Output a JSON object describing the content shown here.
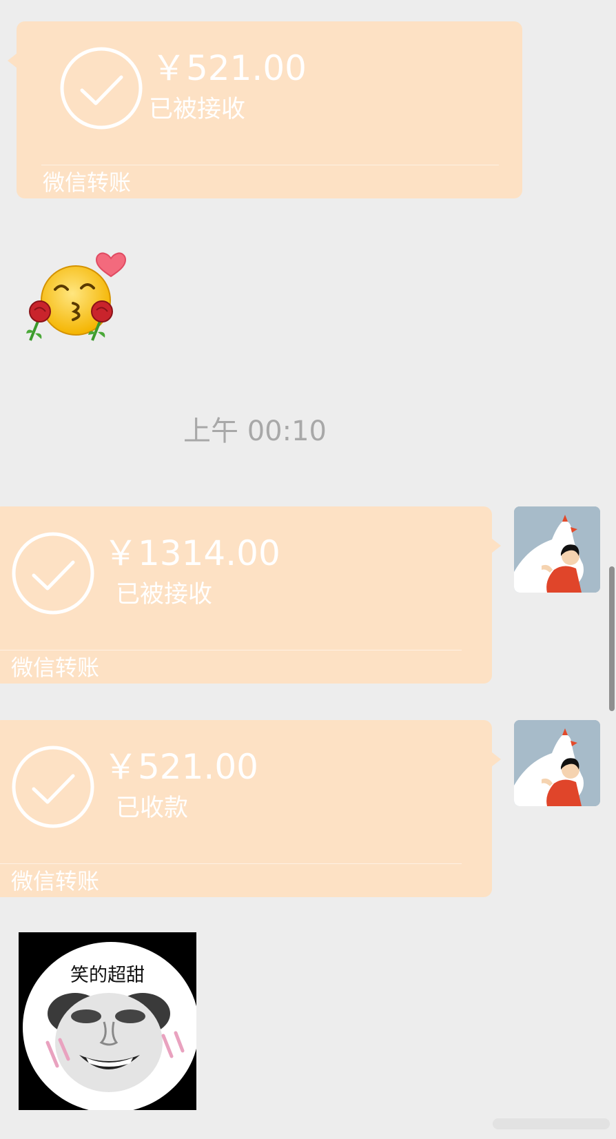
{
  "chat": {
    "timestamp": "上午 00:10",
    "messages": [
      {
        "type": "transfer",
        "direction": "incoming",
        "amount": "￥521.00",
        "status": "已被接收",
        "footer": "微信转账"
      },
      {
        "type": "sticker",
        "direction": "incoming",
        "sticker": "kiss-face-roses-heart"
      },
      {
        "type": "transfer",
        "direction": "outgoing",
        "amount": "￥1314.00",
        "status": "已被接收",
        "footer": "微信转账"
      },
      {
        "type": "transfer",
        "direction": "outgoing",
        "amount": "￥521.00",
        "status": "已收款",
        "footer": "微信转账"
      },
      {
        "type": "sticker",
        "direction": "incoming",
        "sticker": "panda-meme",
        "caption": "笑的超甜"
      }
    ]
  },
  "colors": {
    "background": "#ededed",
    "transfer_card": "#fde1c4",
    "timestamp": "#a8a8a8",
    "avatar_bg": "#a7bbc9"
  },
  "icons": {
    "check": "check-circle-icon",
    "avatar": "user-avatar-goose"
  }
}
